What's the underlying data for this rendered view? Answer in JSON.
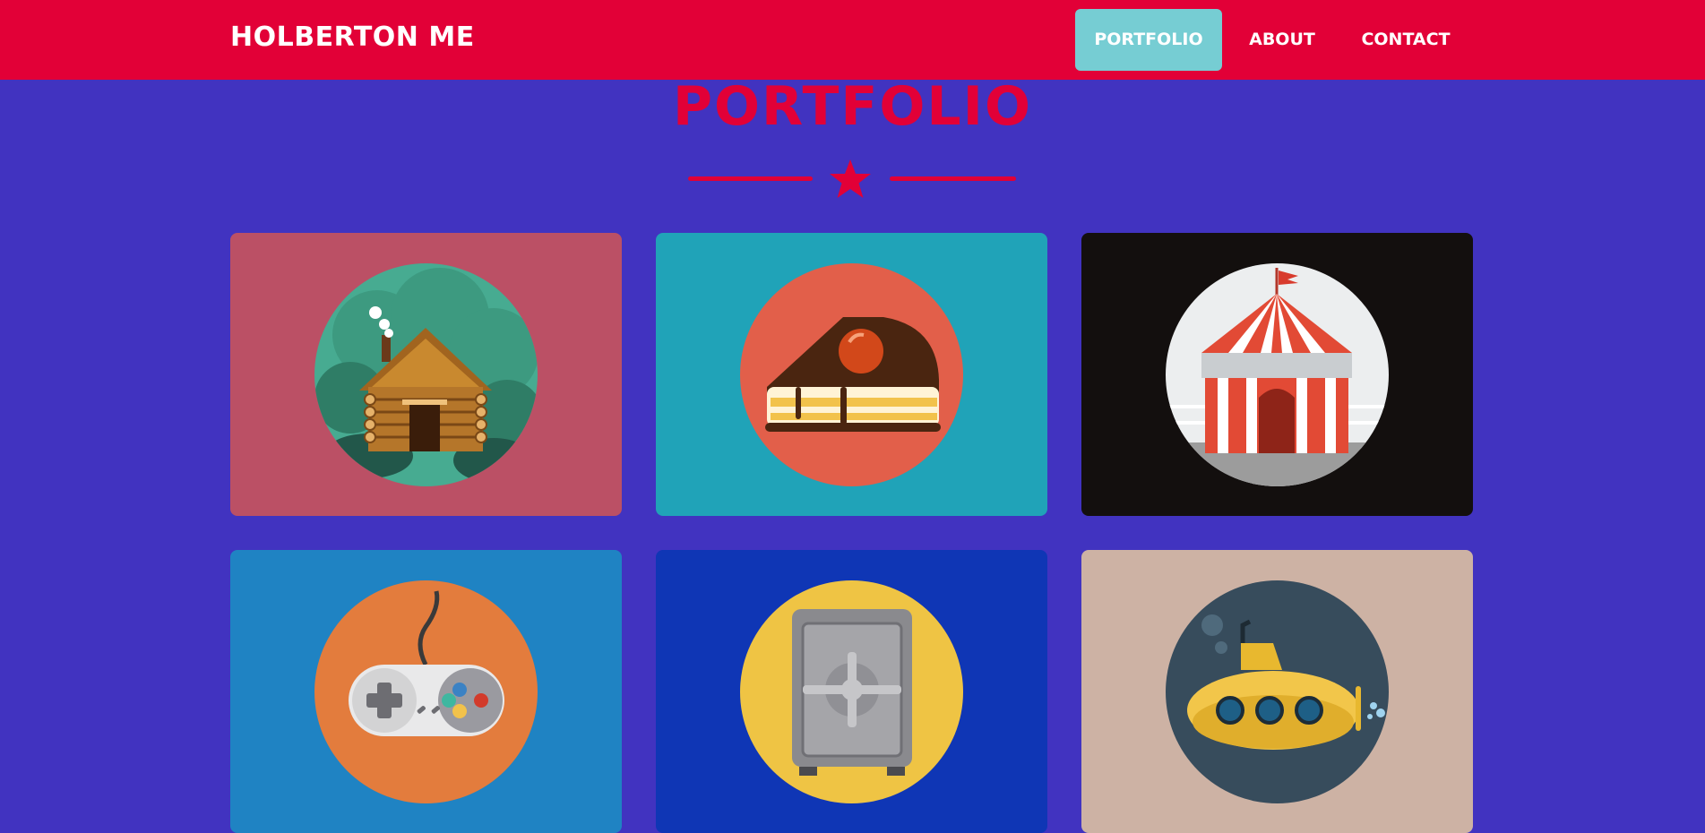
{
  "navbar": {
    "brand": "HOLBERTON ME",
    "links": [
      {
        "label": "PORTFOLIO",
        "active": true
      },
      {
        "label": "ABOUT",
        "active": false
      },
      {
        "label": "CONTACT",
        "active": false
      }
    ]
  },
  "portfolio": {
    "title": "PORTFOLIO",
    "divider_icon": "star-icon",
    "items": [
      {
        "icon": "log-cabin-icon",
        "bg": "#bb5065",
        "circle": "#47ab91"
      },
      {
        "icon": "cake-slice-icon",
        "bg": "#20a3b8",
        "circle": "#e25f4a"
      },
      {
        "icon": "circus-tent-icon",
        "bg": "#130f0e",
        "circle": "#eceeef"
      },
      {
        "icon": "game-controller-icon",
        "bg": "#1f83c3",
        "circle": "#e37c3d"
      },
      {
        "icon": "safe-icon",
        "bg": "#0f36b5",
        "circle": "#efc444"
      },
      {
        "icon": "submarine-icon",
        "bg": "#cdb2a4",
        "circle": "#374c5c"
      }
    ]
  },
  "colors": {
    "page_bg": "#4133c0",
    "brand_red": "#e20037",
    "active_link_bg": "#76cdd3"
  }
}
